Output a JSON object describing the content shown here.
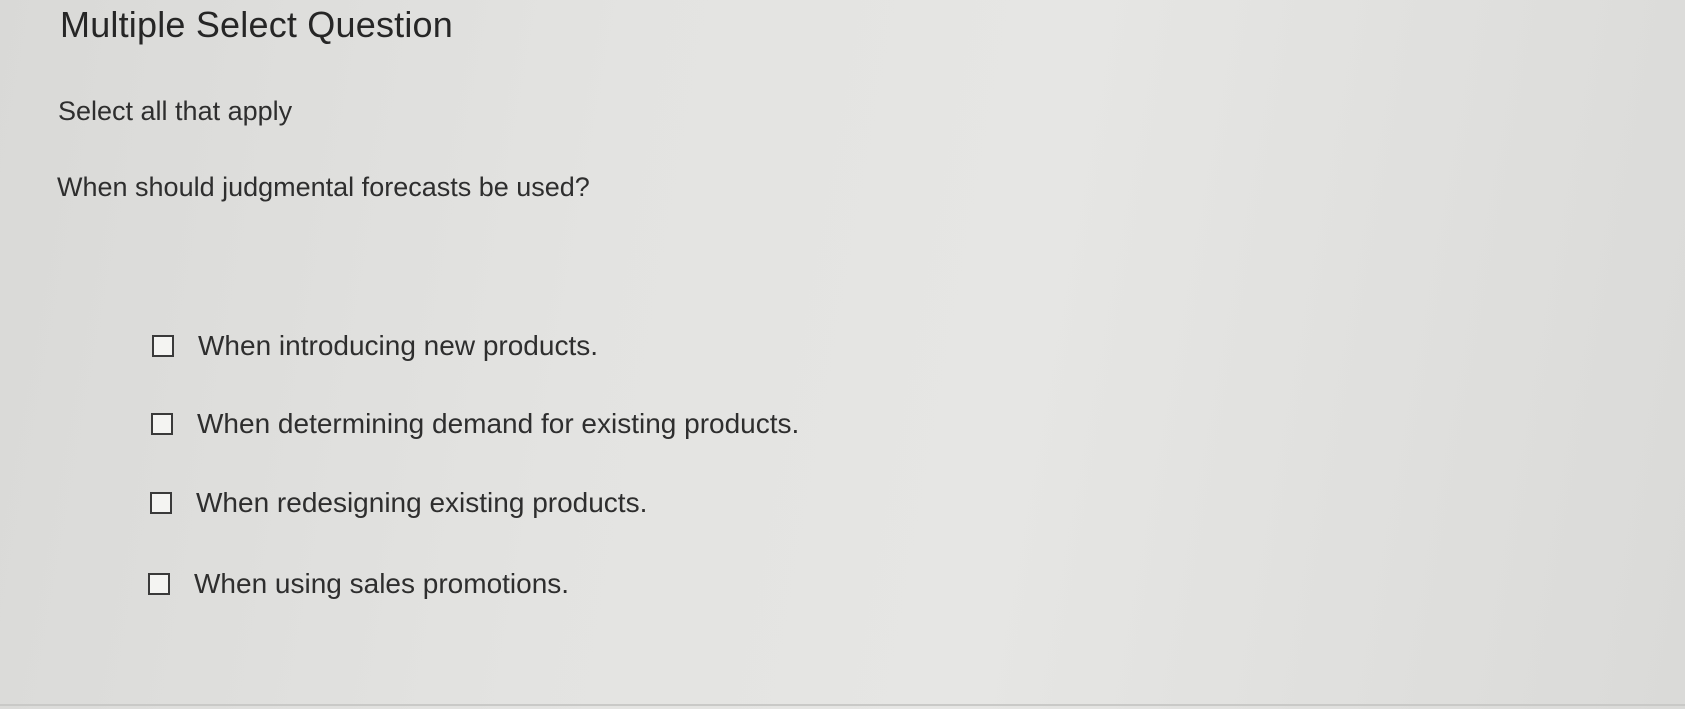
{
  "header": {
    "title": "Multiple Select Question"
  },
  "question": {
    "instruction": "Select all that apply",
    "prompt": "When should judgmental forecasts be used?",
    "options": [
      {
        "label": "When introducing new products.",
        "checked": false
      },
      {
        "label": "When determining demand for existing products.",
        "checked": false
      },
      {
        "label": "When redesigning existing products.",
        "checked": false
      },
      {
        "label": "When using sales promotions.",
        "checked": false
      }
    ]
  },
  "colors": {
    "background": "#e3e3e1",
    "text": "#2e2e2e",
    "checkbox_border": "#3a3a3a"
  }
}
